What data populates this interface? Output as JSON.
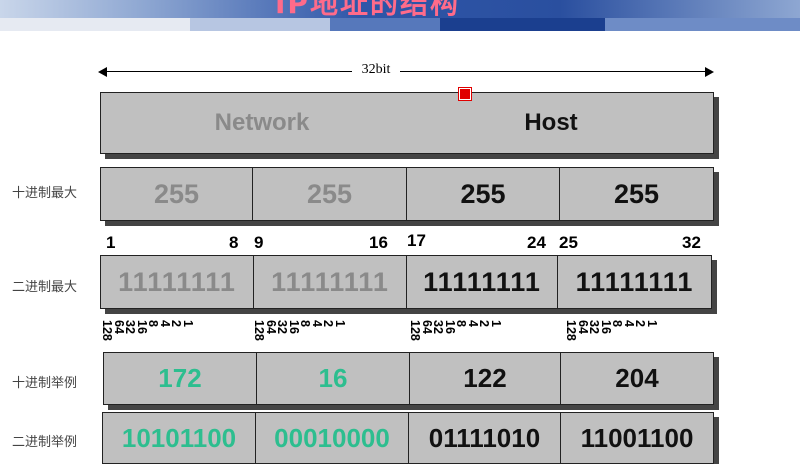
{
  "header": {
    "title": "IP地址的结构"
  },
  "width_label": "32bit",
  "network_host": {
    "network": "Network",
    "host": "Host"
  },
  "rows": {
    "decimal_max": {
      "label": "十进制最大",
      "values": [
        "255",
        "255",
        "255",
        "255"
      ]
    },
    "bit_positions": [
      "1",
      "8",
      "9",
      "16",
      "17",
      "24",
      "25",
      "32"
    ],
    "binary_max": {
      "label": "二进制最大",
      "values": [
        "11111111",
        "11111111",
        "11111111",
        "11111111"
      ]
    },
    "bit_weights": [
      "128",
      "64",
      "32",
      "16",
      "8",
      "4",
      "2",
      "1"
    ],
    "decimal_example": {
      "label": "十进制举例",
      "values": [
        "172",
        "16",
        "122",
        "204"
      ]
    },
    "binary_example": {
      "label": "二进制举例",
      "values": [
        "10101100",
        "00010000",
        "01111010",
        "11001100"
      ]
    }
  },
  "colors": {
    "network_text": "#8a8a8a",
    "host_text": "#111111",
    "example_network_text": "#2dbe8f",
    "box_fill": "#c0c0c0",
    "marker": "#e00000"
  }
}
